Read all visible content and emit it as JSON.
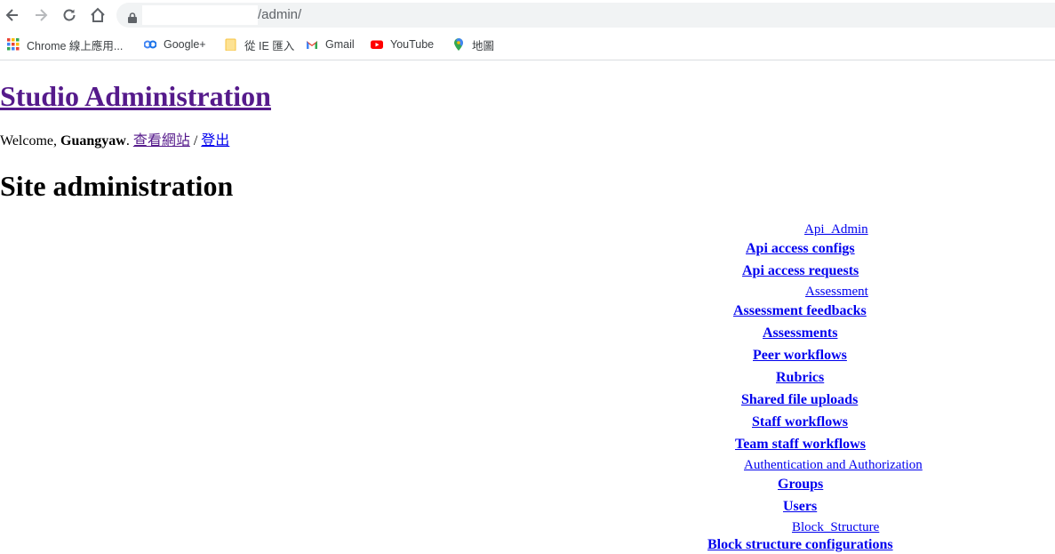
{
  "browser": {
    "url_path": "/admin/",
    "bookmarks": [
      {
        "icon": "chrome-apps-icon",
        "label": "Chrome 線上應用..."
      },
      {
        "icon": "google-plus-icon",
        "label": "Google+"
      },
      {
        "icon": "folder-icon",
        "label": "從 IE 匯入"
      },
      {
        "icon": "gmail-icon",
        "label": "Gmail"
      },
      {
        "icon": "youtube-icon",
        "label": "YouTube"
      },
      {
        "icon": "maps-icon",
        "label": "地圖"
      }
    ]
  },
  "header": {
    "site_title": "Studio Administration",
    "welcome_prefix": "Welcome,",
    "username": "Guangyaw",
    "period": ".",
    "view_site": "查看網站",
    "separator": "/",
    "logout": "登出"
  },
  "main": {
    "title": "Site administration",
    "apps": [
      {
        "caption": "Api_Admin",
        "models": [
          "Api access configs",
          "Api access requests"
        ]
      },
      {
        "caption": "Assessment",
        "models": [
          "Assessment feedbacks",
          "Assessments",
          "Peer workflows",
          "Rubrics",
          "Shared file uploads",
          "Staff workflows",
          "Team staff workflows"
        ]
      },
      {
        "caption": "Authentication and Authorization",
        "models": [
          "Groups",
          "Users"
        ]
      },
      {
        "caption": "Block_Structure",
        "models": [
          "Block structure configurations"
        ]
      }
    ]
  },
  "colors": {
    "visited_link": "#551a8b",
    "link": "#0000ee",
    "omnibox_bg": "#f1f3f4",
    "toolbar_icon": "#5f6368"
  }
}
